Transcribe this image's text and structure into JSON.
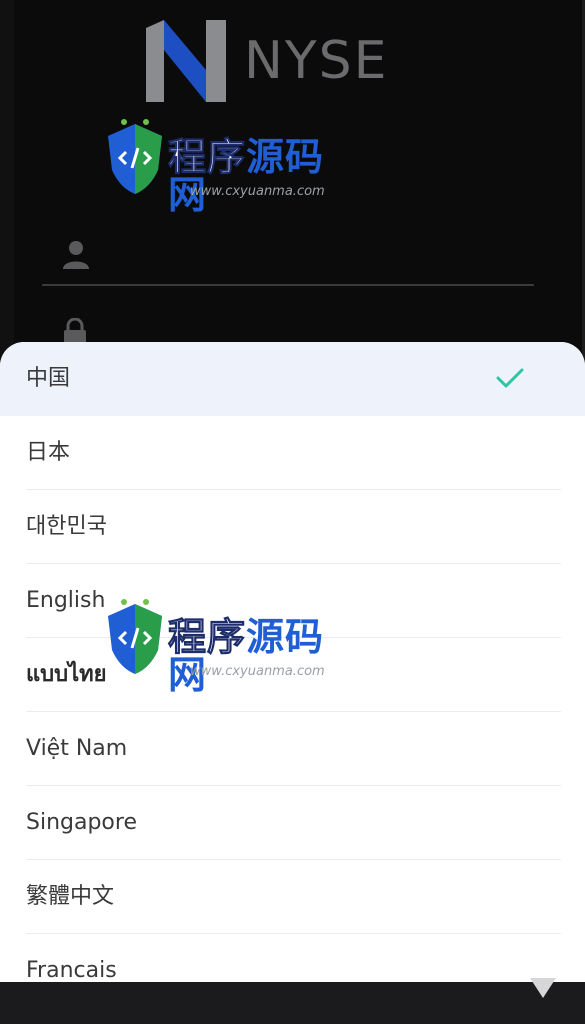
{
  "brand": {
    "name": "NYSE",
    "accent": "#1e4fc2"
  },
  "login": {
    "username_icon": "user-icon",
    "password_icon": "lock-icon"
  },
  "watermark": {
    "cn_part1": "程序",
    "cn_part2": "源码网",
    "url": "www.cxyuanma.com"
  },
  "language_sheet": {
    "items": [
      {
        "label": "中国",
        "selected": true
      },
      {
        "label": "日本",
        "selected": false
      },
      {
        "label": "대한민국",
        "selected": false
      },
      {
        "label": "English",
        "selected": false
      },
      {
        "label": "แบบไทย",
        "selected": false
      },
      {
        "label": "Việt Nam",
        "selected": false
      },
      {
        "label": "Singapore",
        "selected": false
      },
      {
        "label": "繁體中文",
        "selected": false
      },
      {
        "label": "Francais",
        "selected": false
      }
    ],
    "selected_icon": "checkmark-icon",
    "check_color": "#2ec4a6"
  },
  "scroll_indicator_icon": "triangle-down-icon"
}
